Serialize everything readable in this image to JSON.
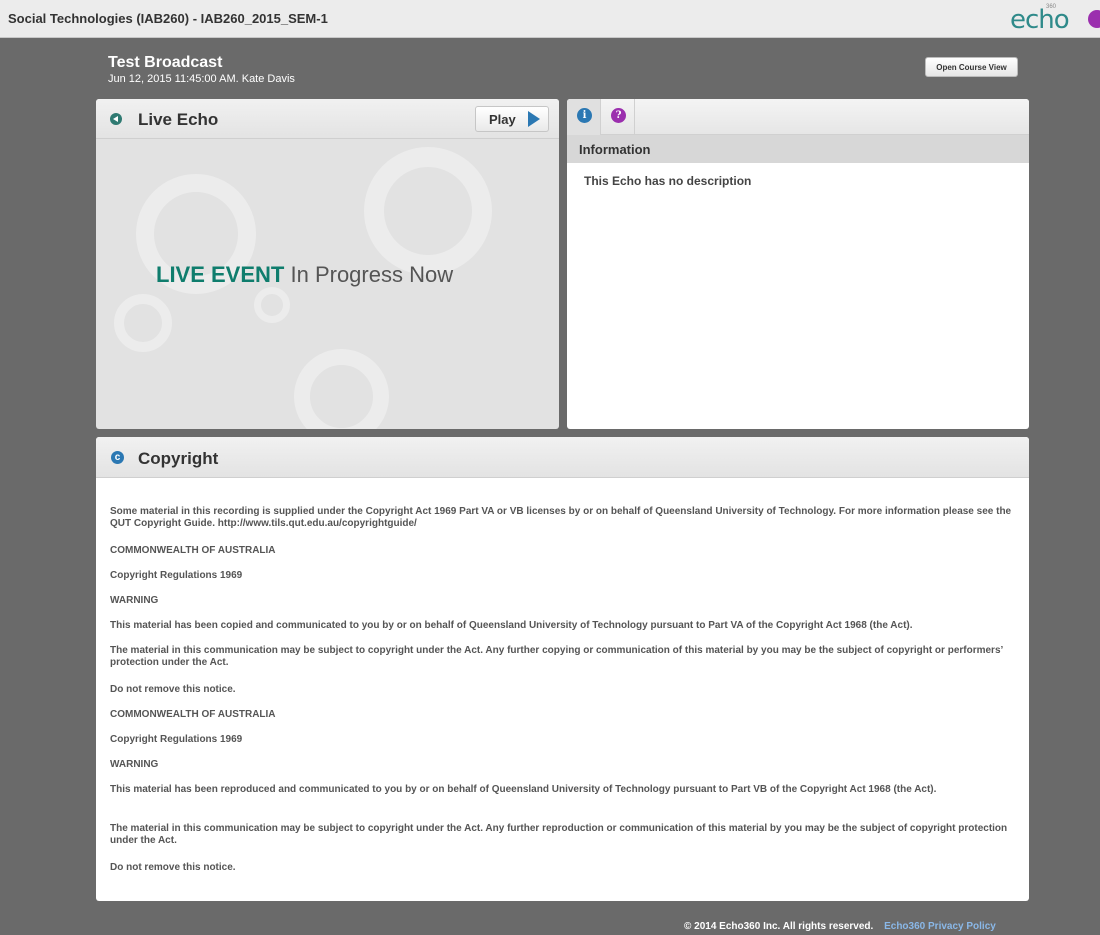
{
  "topbar": {
    "course_title": "Social Technologies (IAB260) - IAB260_2015_SEM-1",
    "logo_text": "echo",
    "logo_sup": "360",
    "user_icon_color": "#9b2fae"
  },
  "header": {
    "title": "Test Broadcast",
    "subtitle": "Jun 12, 2015 11:45:00 AM. Kate Davis",
    "open_course_label": "Open Course View"
  },
  "live": {
    "title": "Live Echo",
    "play_label": "Play",
    "event_strong": "LIVE EVENT",
    "event_rest": "In Progress Now",
    "accent": "#0f7d6d"
  },
  "info": {
    "tabs": [
      {
        "icon": "info-icon",
        "glyph": "i",
        "color": "#2b78b3",
        "active": true
      },
      {
        "icon": "question-icon",
        "glyph": "?",
        "color": "#9b2fae",
        "active": false
      }
    ],
    "section_title": "Information",
    "description": "This Echo has no description"
  },
  "copyright": {
    "title": "Copyright",
    "icon_glyph": "c",
    "lines": [
      "Some material in this recording is supplied under the Copyright Act 1969 Part VA or VB licenses by or on behalf of Queensland University of Technology. For more information please see the QUT Copyright Guide. http://www.tils.qut.edu.au/copyrightguide/",
      "COMMONWEALTH OF AUSTRALIA",
      "Copyright Regulations 1969",
      "WARNING",
      "This material has been copied and communicated to you by or on behalf of Queensland University of Technology pursuant to Part VA of the Copyright Act 1968 (the Act).",
      "The material in this communication may be subject to copyright under the Act. Any further copying or communication of this material by you may be the subject of copyright or performers’ protection under the Act.",
      "Do not remove this notice.",
      "COMMONWEALTH OF AUSTRALIA",
      "Copyright Regulations 1969",
      "WARNING",
      "This material has been reproduced and communicated to you by or on behalf of Queensland University of Technology pursuant to Part VB of the Copyright Act 1968 (the Act).",
      "The material in this communication may be subject to copyright under the Act. Any further reproduction or communication of this material by you may be the subject of copyright protection under the Act.",
      "Do not remove this notice."
    ]
  },
  "footer": {
    "copyright_text": "© 2014 Echo360 Inc. All rights reserved.",
    "privacy_link": "Echo360 Privacy Policy"
  }
}
